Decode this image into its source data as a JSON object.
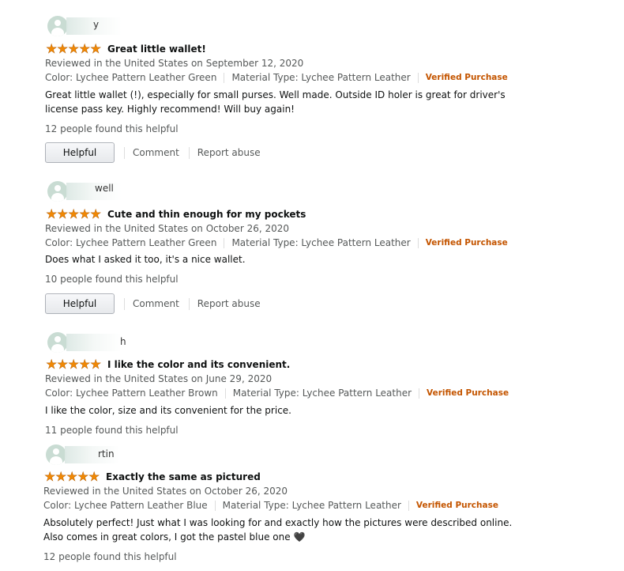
{
  "reviews": [
    {
      "name_fragment": "y",
      "stars": 5,
      "title": "Great little wallet!",
      "date": "Reviewed in the United States on September 12, 2020",
      "color": "Color: Lychee Pattern Leather Green",
      "material": "Material Type: Lychee Pattern Leather",
      "verified": "Verified Purchase",
      "body": "Great little wallet (!), especially for small purses. Well made. Outside ID holer is great for driver's license pass key. Highly recommend! Will buy again!",
      "helpful_count": "12 people found this helpful",
      "helpful_label": "Helpful",
      "comment_label": "Comment",
      "report_label": "Report abuse"
    },
    {
      "name_fragment": "well",
      "stars": 5,
      "title": "Cute and thin enough for my pockets",
      "date": "Reviewed in the United States on October 26, 2020",
      "color": "Color: Lychee Pattern Leather Green",
      "material": "Material Type: Lychee Pattern Leather",
      "verified": "Verified Purchase",
      "body": "Does what I asked it too, it's a nice wallet.",
      "helpful_count": "10 people found this helpful",
      "helpful_label": "Helpful",
      "comment_label": "Comment",
      "report_label": "Report abuse"
    },
    {
      "name_fragment": "h",
      "stars": 5,
      "title": "I like the color and its convenient.",
      "date": "Reviewed in the United States on June 29, 2020",
      "color": "Color: Lychee Pattern Leather Brown",
      "material": "Material Type: Lychee Pattern Leather",
      "verified": "Verified Purchase",
      "body": "I like the color, size and its convenient for the price.",
      "helpful_count": "11 people found this helpful"
    },
    {
      "name_fragment": "rtin",
      "stars": 5,
      "title": "Exactly the same as pictured",
      "date": "Reviewed in the United States on October 26, 2020",
      "color": "Color: Lychee Pattern Leather Blue",
      "material": "Material Type: Lychee Pattern Leather",
      "verified": "Verified Purchase",
      "body": "Absolutely perfect! Just what I was looking for and exactly how the pictures were described online. Also comes in great colors, I got the pastel blue one 🖤",
      "helpful_count": "12 people found this helpful"
    }
  ],
  "colors": {
    "star": "#f08804",
    "verified": "#c45500",
    "muted": "#565959"
  },
  "icons": {
    "avatar": "user-avatar-icon",
    "star": "star-icon"
  }
}
